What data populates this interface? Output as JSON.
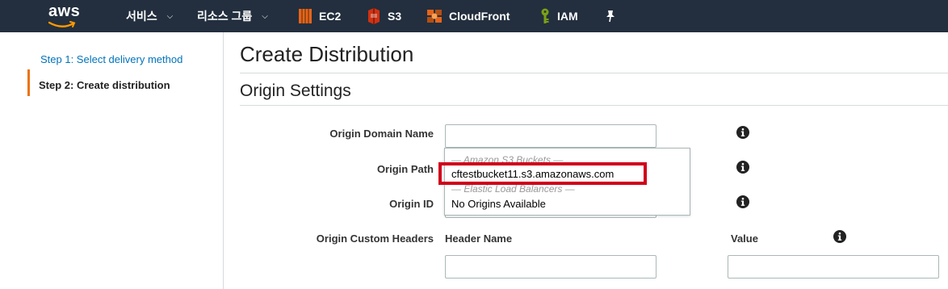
{
  "nav": {
    "logo": "aws",
    "services": "서비스",
    "resource_groups": "리소스 그룹",
    "links": [
      {
        "label": "EC2",
        "icon": "ec2-icon",
        "color": "#e8641a"
      },
      {
        "label": "S3",
        "icon": "s3-icon",
        "color": "#d13212"
      },
      {
        "label": "CloudFront",
        "icon": "cloudfront-icon",
        "color": "#e8641a"
      },
      {
        "label": "IAM",
        "icon": "iam-icon",
        "color": "#7aa116"
      }
    ],
    "pin_icon": "pin-icon"
  },
  "sidebar": {
    "step1": "Step 1: Select delivery method",
    "step2": "Step 2: Create distribution"
  },
  "main": {
    "title": "Create Distribution",
    "section": "Origin Settings",
    "fields": {
      "origin_domain": {
        "label": "Origin Domain Name",
        "value": ""
      },
      "origin_path": {
        "label": "Origin Path"
      },
      "origin_id": {
        "label": "Origin ID"
      },
      "custom_headers": {
        "label": "Origin Custom Headers",
        "header_name": "Header Name",
        "value": "Value"
      }
    },
    "dropdown": {
      "group1": "— Amazon S3 Buckets —",
      "option1": "cftestbucket11.s3.amazonaws.com",
      "group2": "— Elastic Load Balancers —",
      "option2": "No Origins Available"
    }
  },
  "colors": {
    "nav_bg": "#232f3e",
    "accent": "#ec7211",
    "link": "#0073bb",
    "highlight": "#d0021b"
  }
}
